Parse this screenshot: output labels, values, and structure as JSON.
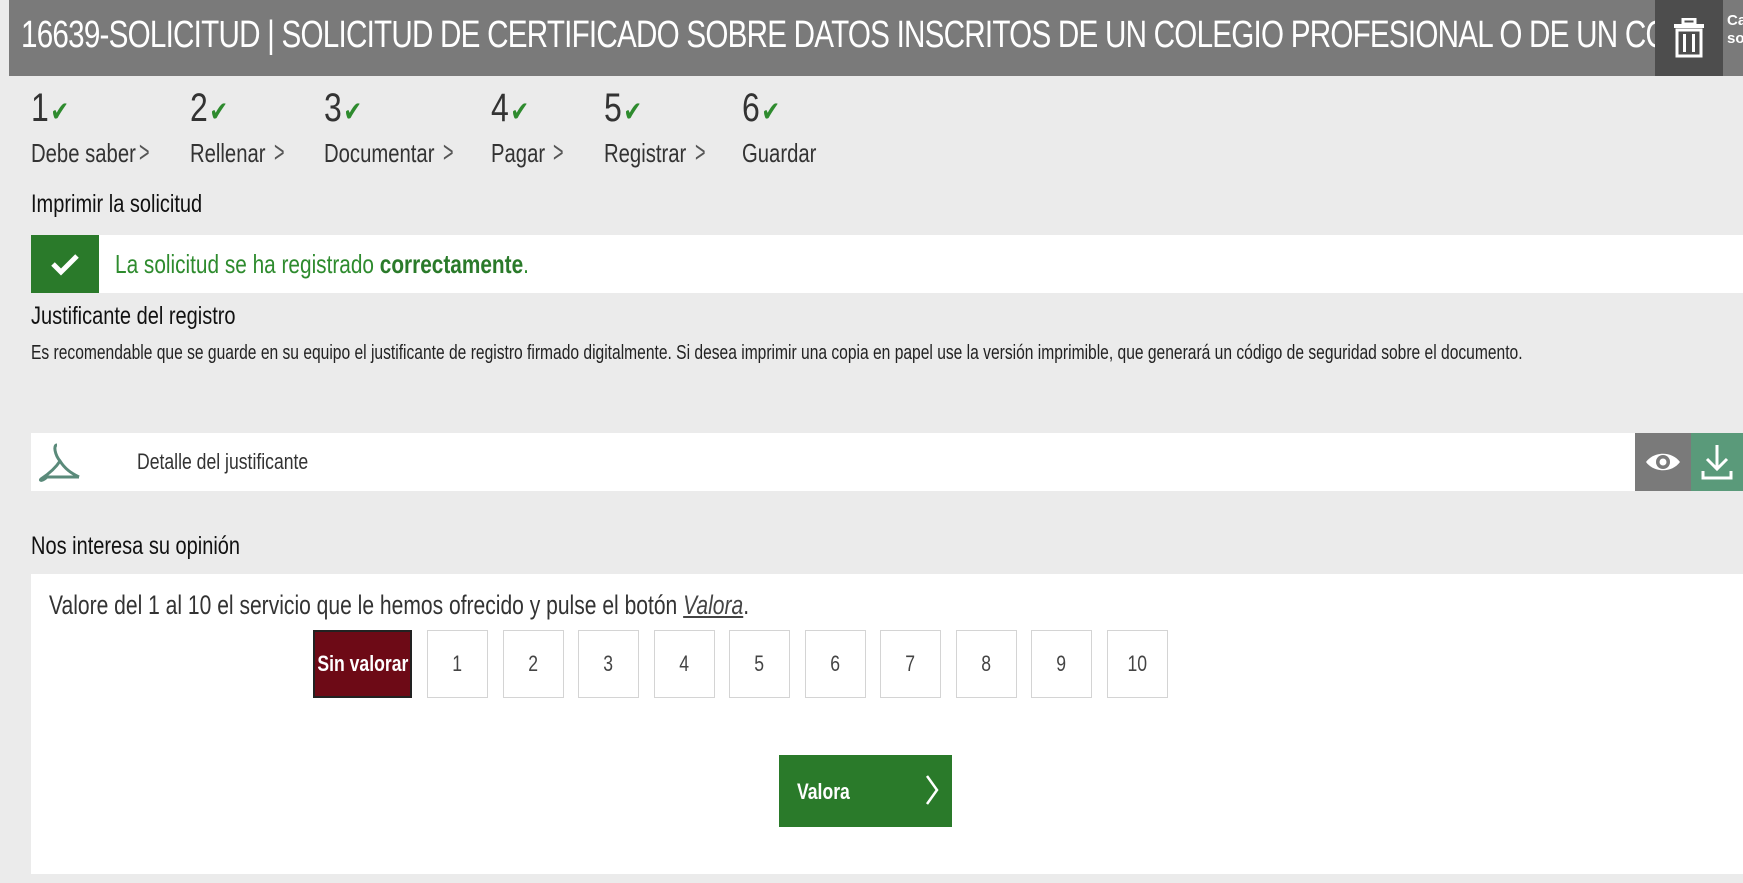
{
  "header": {
    "title": "16639-SOLICITUD | SOLICITUD DE CERTIFICADO SOBRE DATOS INSCRITOS DE UN COLEGIO PROFESIONAL O DE UN CON...",
    "cut_text_line1": "Ca",
    "cut_text_line2": "so"
  },
  "steps": [
    {
      "number": "1",
      "label": "Debe saber",
      "done": true
    },
    {
      "number": "2",
      "label": "Rellenar",
      "done": true
    },
    {
      "number": "3",
      "label": "Documentar",
      "done": true
    },
    {
      "number": "4",
      "label": "Pagar",
      "done": true
    },
    {
      "number": "5",
      "label": "Registrar",
      "done": true
    },
    {
      "number": "6",
      "label": "Guardar",
      "done": true
    }
  ],
  "print_section": {
    "title": "Imprimir la solicitud",
    "success_prefix": "La solicitud se ha registrado ",
    "success_bold": "correctamente",
    "success_suffix": "."
  },
  "receipt": {
    "title": "Justificante del registro",
    "description": "Es recomendable que se guarde en su equipo el justificante de registro firmado digitalmente. Si desea imprimir una copia en papel use la versión imprimible, que generará un código de seguridad sobre el documento.",
    "file_name": "Detalle del justificante"
  },
  "opinion": {
    "title": "Nos interesa su opinión",
    "prompt_prefix": "Valore del 1 al 10 el servicio que le hemos ofrecido y pulse el botón ",
    "prompt_link": "Valora",
    "prompt_suffix": ".",
    "options": [
      "Sin valorar",
      "1",
      "2",
      "3",
      "4",
      "5",
      "6",
      "7",
      "8",
      "9",
      "10"
    ],
    "selected": "Sin valorar",
    "submit_label": "Valora"
  },
  "colors": {
    "titlebar": "#7a7a7a",
    "success_green": "#2a7a2a",
    "selected_rating": "#6d0a16"
  }
}
